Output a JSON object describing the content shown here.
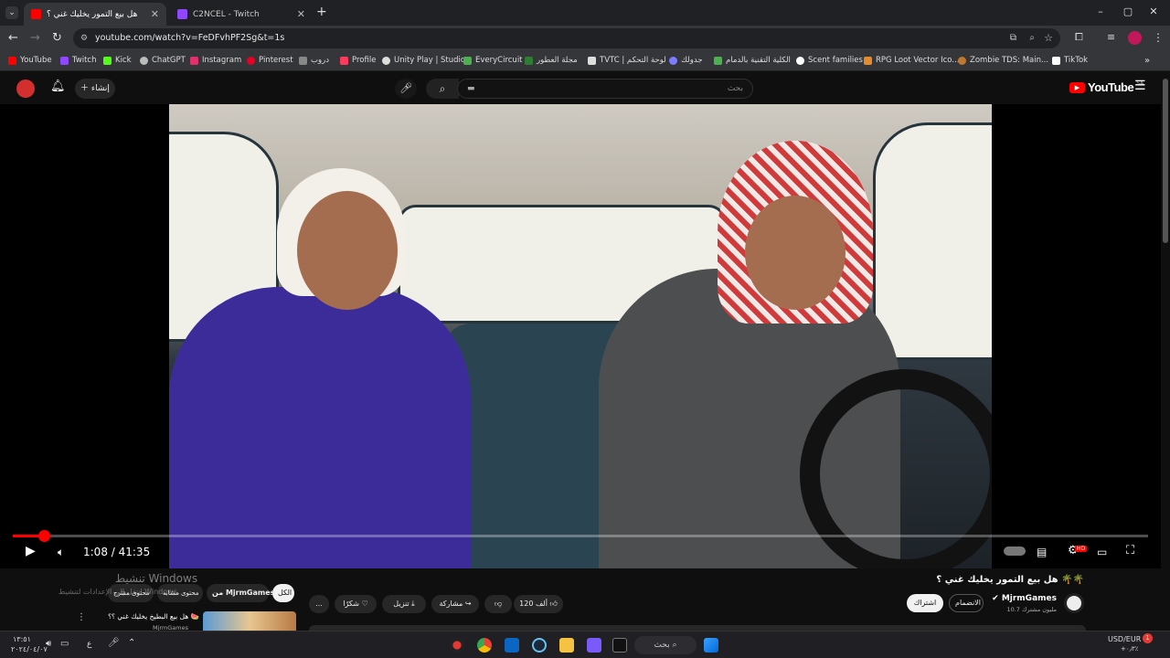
{
  "tabs": [
    {
      "title": "هل بيع التمور يخليك غني ؟",
      "active": true
    },
    {
      "title": "C2NCEL - Twitch",
      "active": false
    }
  ],
  "new_tab": "+",
  "window_controls": {
    "minimize": "–",
    "maximize": "▢",
    "close": "✕"
  },
  "address": {
    "url": "youtube.com/watch?v=FeDFvhPF2Sg&t=1s"
  },
  "bookmarks": [
    {
      "label": "YouTube",
      "color": "#ff0000"
    },
    {
      "label": "Twitch",
      "color": "#9146ff"
    },
    {
      "label": "Kick",
      "color": "#53fc18"
    },
    {
      "label": "ChatGPT",
      "color": "#bbbbbb"
    },
    {
      "label": "Instagram",
      "color": "#e1306c"
    },
    {
      "label": "Pinterest",
      "color": "#e60023"
    },
    {
      "label": "دروب",
      "color": "#888888"
    },
    {
      "label": "Profile",
      "color": "#ff3b5c"
    },
    {
      "label": "Unity Play | Studio",
      "color": "#dddddd"
    },
    {
      "label": "EveryCircuit",
      "color": "#4caf50"
    },
    {
      "label": "مجلة العطور",
      "color": "#2e7d32"
    },
    {
      "label": "TVTC | لوحة التحكم",
      "color": "#dddddd"
    },
    {
      "label": "جدولك",
      "color": "#7c7cff"
    },
    {
      "label": "الكلية التقنية بالدمام",
      "color": "#4caf50"
    },
    {
      "label": "Scent families",
      "color": "#ffffff"
    },
    {
      "label": "RPG Loot Vector Ico...",
      "color": "#e68a2e"
    },
    {
      "label": "Zombie TDS: Main...",
      "color": "#c0782e"
    },
    {
      "label": "TikTok",
      "color": "#ffffff"
    }
  ],
  "youtube": {
    "create_label": "إنشاء",
    "search_placeholder": "بحث",
    "logo_text": "YouTube",
    "region": "SA"
  },
  "player": {
    "current_time": "1:08",
    "duration": "41:35",
    "time_display": "1:08 / 41:35",
    "progress_fraction": 0.027
  },
  "video_info": {
    "title": "هل بيع التمور يخليك غني ؟ 🌴🌴",
    "channel_name": "MjrmGames",
    "subscribers": "10.7 مليون مشترك",
    "join_label": "الانضمام",
    "subscribe_label": "اشتراك",
    "likes": "120 ألف",
    "share_label": "مشاركة",
    "download_label": "تنزيل",
    "thanks_label": "شكرًا",
    "more_label": "...",
    "filter_all": "الكل",
    "filter_from": "من MjrmGames",
    "filter_related": "محتوى مشابه",
    "filter_related2": "محتوى مقترح"
  },
  "watermark": {
    "line1": "تنشيط Windows",
    "line2": "انتقل إلى الإعدادات لتنشيط Windows."
  },
  "recommended": {
    "title": "هل بيع البطيخ يخليك غني ؟؟ 🍉",
    "channel": "MjrmGames"
  },
  "taskbar": {
    "search_label": "بحث",
    "currency": "USD/EUR",
    "currency_value": "+٠٫٣٪",
    "time": "١٣:٥١",
    "date": "٢٠٢٤/٠٤/٠٧",
    "lang": "ع",
    "notif_count": "1"
  }
}
